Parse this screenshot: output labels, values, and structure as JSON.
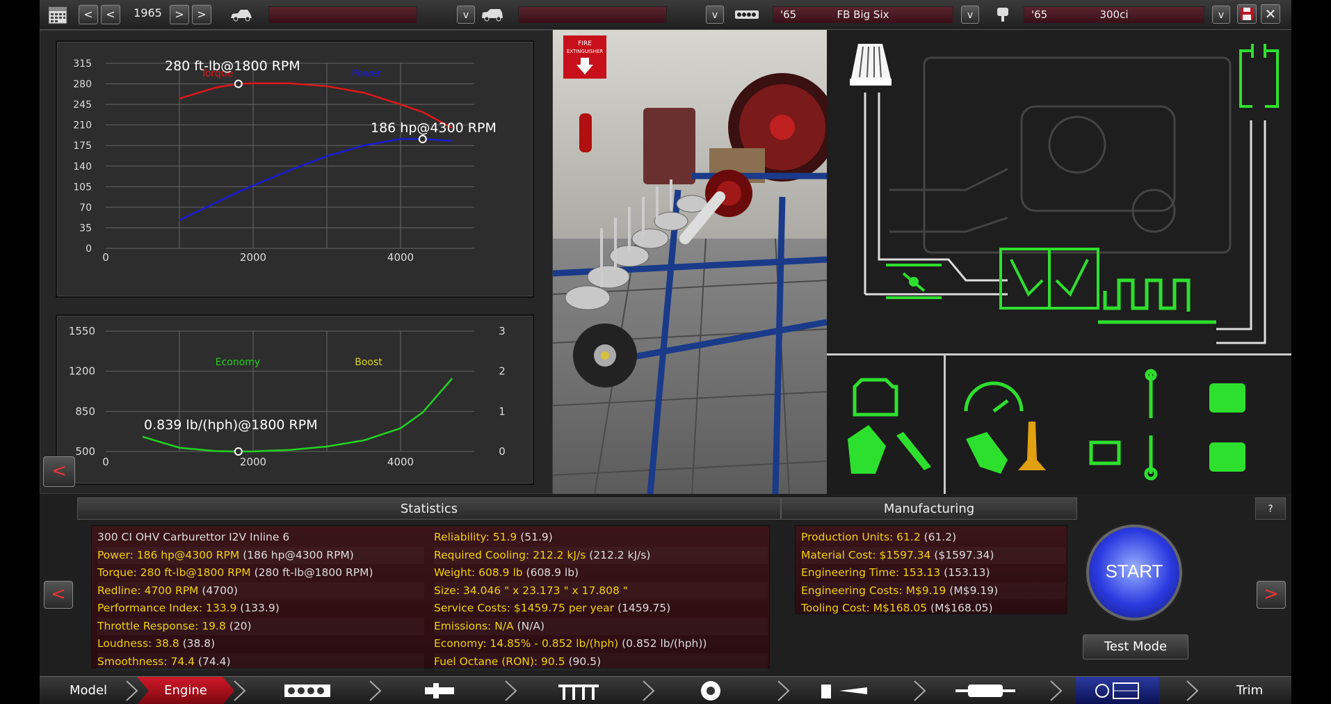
{
  "toolbar": {
    "year": "1965",
    "year_prev2": "<",
    "year_prev1": "<",
    "year_next1": ">",
    "year_next2": ">",
    "model_dropdown": "v",
    "trim_dropdown": "v",
    "engine_family_year": "'65",
    "engine_family_name": "FB Big Six",
    "engine_family_dropdown": "v",
    "engine_variant_year": "'65",
    "engine_variant_name": "300ci",
    "engine_variant_dropdown": "v"
  },
  "torque_chart": {
    "series1_label": "Torque",
    "series2_label": "Power",
    "annotation_torque": "280 ft-lb@1800 RPM",
    "annotation_power": "186 hp@4300 RPM",
    "yticks": [
      "315",
      "280",
      "245",
      "210",
      "175",
      "140",
      "105",
      "70",
      "35",
      "0"
    ],
    "xticks": [
      "0",
      "2000",
      "4000"
    ]
  },
  "economy_chart": {
    "series1_label": "Economy",
    "series2_label": "Boost",
    "annotation": "0.839 lb/(hph)@1800 RPM",
    "yticks_left": [
      "1550",
      "1200",
      "850",
      "500"
    ],
    "yticks_right": [
      "3",
      "2",
      "1",
      "0"
    ],
    "xticks": [
      "0",
      "2000",
      "4000"
    ]
  },
  "chart_data": [
    {
      "type": "line",
      "x": [
        1000,
        1500,
        1800,
        2000,
        2500,
        3000,
        3500,
        4000,
        4300,
        4700
      ],
      "series": [
        {
          "name": "Torque",
          "values": [
            255,
            274,
            280,
            281,
            281,
            276,
            265,
            245,
            232,
            205
          ]
        },
        {
          "name": "Power",
          "values": [
            48,
            78,
            96,
            107,
            133,
            157,
            175,
            186,
            186,
            183
          ]
        }
      ],
      "xlim": [
        0,
        5000
      ],
      "ylim": [
        0,
        315
      ],
      "colors": {
        "Torque": "#e01818",
        "Power": "#1a1ad8"
      },
      "annotations": [
        "280 ft-lb@1800 RPM",
        "186 hp@4300 RPM"
      ]
    },
    {
      "type": "line",
      "x": [
        500,
        1000,
        1500,
        1800,
        2000,
        2500,
        3000,
        3500,
        4000,
        4300,
        4700
      ],
      "series": [
        {
          "name": "Economy",
          "values": [
            0.96,
            0.87,
            0.842,
            0.839,
            0.84,
            0.852,
            0.88,
            0.93,
            1.03,
            1.16,
            1.44
          ]
        }
      ],
      "ylim_left": [
        500,
        1550
      ],
      "ylim_right": [
        0,
        3
      ],
      "xlim": [
        0,
        5000
      ],
      "colors": {
        "Economy": "#22d422",
        "Boost": "#d8d820"
      },
      "annotations": [
        "0.839 lb/(hph)@1800 RPM"
      ]
    }
  ],
  "statistics": {
    "header": "Statistics",
    "left": [
      {
        "label": "300 CI OHV Carburettor I2V Inline 6",
        "value": ""
      },
      {
        "label": "Power: 186 hp@4300 RPM",
        "value": "(186 hp@4300 RPM)"
      },
      {
        "label": "Torque: 280 ft-lb@1800 RPM",
        "value": "(280 ft-lb@1800 RPM)"
      },
      {
        "label": "Redline: 4700 RPM",
        "value": "(4700)"
      },
      {
        "label": "Performance Index: 133.9",
        "value": "(133.9)"
      },
      {
        "label": "Throttle Response: 19.8",
        "value": "(20)"
      },
      {
        "label": "Loudness: 38.8",
        "value": "(38.8)"
      },
      {
        "label": "Smoothness: 74.4",
        "value": "(74.4)"
      }
    ],
    "right": [
      {
        "label": "Reliability: 51.9",
        "value": "(51.9)"
      },
      {
        "label": "Required Cooling: 212.2 kJ/s",
        "value": "(212.2 kJ/s)"
      },
      {
        "label": "Weight: 608.9 lb",
        "value": "(608.9 lb)"
      },
      {
        "label": "Size: 34.046 \" x 23.173 \" x 17.808 \"",
        "value": ""
      },
      {
        "label": "Service Costs: $1459.75 per year",
        "value": "(1459.75)"
      },
      {
        "label": "Emissions: N/A",
        "value": "(N/A)"
      },
      {
        "label": "Economy: 14.85% - 0.852 lb/(hph)",
        "value": "(0.852 lb/(hph))"
      },
      {
        "label": "Fuel Octane (RON): 90.5",
        "value": "(90.5)"
      }
    ]
  },
  "manufacturing": {
    "header": "Manufacturing",
    "rows": [
      {
        "label": "Production Units: 61.2",
        "value": "(61.2)"
      },
      {
        "label": "Material Cost: $1597.34",
        "value": "($1597.34)"
      },
      {
        "label": "Engineering Time: 153.13",
        "value": "(153.13)"
      },
      {
        "label": "Engineering Costs: M$9.19",
        "value": "(M$9.19)"
      },
      {
        "label": "Tooling Cost: M$168.05",
        "value": "(M$168.05)"
      }
    ]
  },
  "controls": {
    "start_label": "START",
    "test_mode_label": "Test Mode",
    "help_label": "?",
    "back_label": "<",
    "prev_label": "<",
    "next_label": ">",
    "fire_sign": "FIRE EXTINGUISHER"
  },
  "navbar": {
    "model": "Model",
    "engine": "Engine",
    "trim": "Trim"
  },
  "colors": {
    "accent_red": "#c0101a",
    "stat_yellow": "#f0d010",
    "engine_green": "#2ee02e",
    "start_blue": "#2a3ae0"
  }
}
